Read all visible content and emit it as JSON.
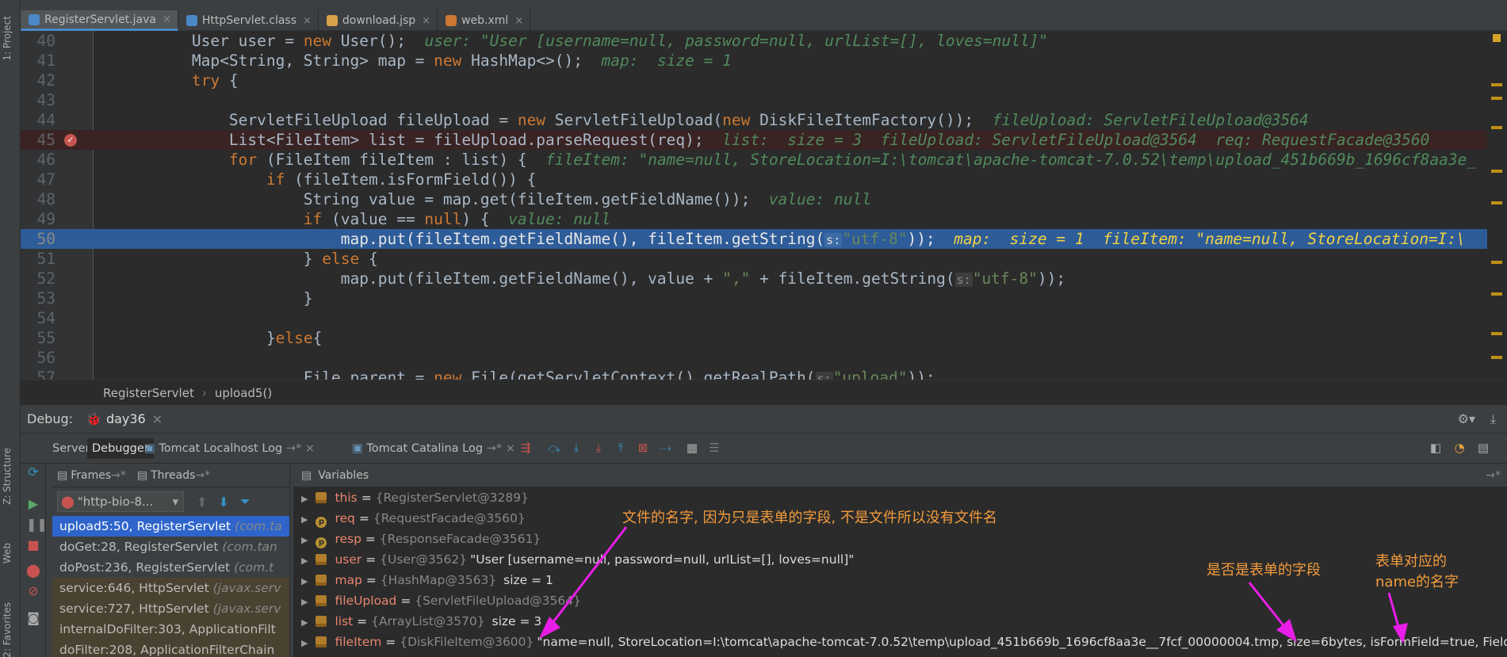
{
  "tabs": [
    {
      "label": "RegisterServlet.java",
      "color": "#4a88c7",
      "active": true
    },
    {
      "label": "HttpServlet.class",
      "color": "#4a88c7",
      "active": false
    },
    {
      "label": "download.jsp",
      "color": "#d6a14a",
      "active": false
    },
    {
      "label": "web.xml",
      "color": "#cc7832",
      "active": false
    }
  ],
  "left_toolwindows": {
    "project": "1: Project",
    "structure": "Z: Structure",
    "web": "Web",
    "favorites": "2: Favorites"
  },
  "code_lines": [
    {
      "num": "40",
      "parts": [
        [
          "",
          "        User user = "
        ],
        [
          "kw",
          "new"
        ],
        [
          "",
          " User();  "
        ],
        [
          "inl",
          "user: \"User [username=null, password=null, urlList=[], loves=null]\""
        ]
      ]
    },
    {
      "num": "41",
      "parts": [
        [
          "",
          "        Map<String, String> map = "
        ],
        [
          "kw",
          "new"
        ],
        [
          "",
          " HashMap<>();  "
        ],
        [
          "inl",
          "map:  size = 1"
        ]
      ]
    },
    {
      "num": "42",
      "parts": [
        [
          "kw",
          "        try"
        ],
        [
          "",
          " {"
        ]
      ]
    },
    {
      "num": "43",
      "parts": [
        [
          "",
          ""
        ]
      ]
    },
    {
      "num": "44",
      "parts": [
        [
          "",
          "            ServletFileUpload fileUpload = "
        ],
        [
          "kw",
          "new"
        ],
        [
          "",
          " ServletFileUpload("
        ],
        [
          "kw",
          "new"
        ],
        [
          "",
          " DiskFileItemFactory());  "
        ],
        [
          "inl",
          "fileUpload: ServletFileUpload@3564"
        ]
      ]
    },
    {
      "num": "45",
      "parts": [
        [
          "",
          "            List<FileItem> list = fileUpload.parseRequest(req);  "
        ],
        [
          "inl",
          "list:  size = 3  fileUpload: ServletFileUpload@3564  req: RequestFacade@3560"
        ]
      ]
    },
    {
      "num": "46",
      "parts": [
        [
          "kw",
          "            for"
        ],
        [
          "",
          " (FileItem fileItem : list) {  "
        ],
        [
          "inl",
          "fileItem: \"name=null, StoreLocation=I:\\tomcat\\apache-tomcat-7.0.52\\temp\\upload_451b669b_1696cf8aa3e_"
        ]
      ]
    },
    {
      "num": "47",
      "parts": [
        [
          "kw",
          "                if"
        ],
        [
          "",
          " (fileItem.isFormField()) {"
        ]
      ]
    },
    {
      "num": "48",
      "parts": [
        [
          "",
          "                    String value = map.get(fileItem.getFieldName());  "
        ],
        [
          "inl",
          "value: null"
        ]
      ]
    },
    {
      "num": "49",
      "parts": [
        [
          "kw",
          "                    if"
        ],
        [
          "",
          " (value == "
        ],
        [
          "kw",
          "null"
        ],
        [
          "",
          ") {  "
        ],
        [
          "inl",
          "value: null"
        ]
      ]
    },
    {
      "num": "50",
      "parts": [
        [
          "",
          "                        map.put(fileItem.getFieldName(), fileItem.getString("
        ],
        [
          "ph",
          "s:"
        ],
        [
          "str",
          "\"utf-8\""
        ],
        [
          "",
          "));  "
        ],
        [
          "inl",
          "map:  size = 1  fileItem: \"name=null, StoreLocation=I:\\"
        ]
      ]
    },
    {
      "num": "51",
      "parts": [
        [
          "",
          "                    } "
        ],
        [
          "kw",
          "else"
        ],
        [
          "",
          " {"
        ]
      ]
    },
    {
      "num": "52",
      "parts": [
        [
          "",
          "                        map.put(fileItem.getFieldName(), value + "
        ],
        [
          "str",
          "\",\""
        ],
        [
          "",
          " + fileItem.getString("
        ],
        [
          "ph",
          "s:"
        ],
        [
          "str",
          "\"utf-8\""
        ],
        [
          "",
          "));"
        ]
      ]
    },
    {
      "num": "53",
      "parts": [
        [
          "",
          "                    }"
        ]
      ]
    },
    {
      "num": "54",
      "parts": [
        [
          "",
          ""
        ]
      ]
    },
    {
      "num": "55",
      "parts": [
        [
          "",
          "                }"
        ],
        [
          "kw",
          "else"
        ],
        [
          "",
          "{"
        ]
      ]
    },
    {
      "num": "56",
      "parts": [
        [
          "",
          ""
        ]
      ]
    },
    {
      "num": "57",
      "parts": [
        [
          "",
          "                    File parent = "
        ],
        [
          "kw",
          "new"
        ],
        [
          "",
          " File(getServletContext().getRealPath("
        ],
        [
          "ph",
          "s:"
        ],
        [
          "str",
          "\"upload\""
        ],
        [
          "",
          "));"
        ]
      ]
    }
  ],
  "breakpoint_line": "45",
  "current_line": "50",
  "breadcrumb": {
    "class": "RegisterServlet",
    "method": "upload5()"
  },
  "debug": {
    "title": "Debug:",
    "session": "day36",
    "tabs": [
      "Server",
      "Debugger",
      "Tomcat Localhost Log",
      "Tomcat Catalina Log"
    ],
    "frames_label": "Frames",
    "threads_label": "Threads",
    "variables_label": "Variables",
    "thread": "\"http-bio-8...",
    "frames": [
      {
        "text": "upload5:50, RegisterServlet",
        "pkg": "(com.ta",
        "state": "sel"
      },
      {
        "text": "doGet:28, RegisterServlet",
        "pkg": "(com.tan",
        "state": ""
      },
      {
        "text": "doPost:236, RegisterServlet",
        "pkg": "(com.t",
        "state": ""
      },
      {
        "text": "service:646, HttpServlet",
        "pkg": "(javax.serv",
        "state": "lib"
      },
      {
        "text": "service:727, HttpServlet",
        "pkg": "(javax.serv",
        "state": "lib"
      },
      {
        "text": "internalDoFilter:303, ApplicationFilt",
        "pkg": "",
        "state": "lib"
      },
      {
        "text": "doFilter:208, ApplicationFilterChain",
        "pkg": "",
        "state": "lib"
      }
    ],
    "variables": [
      {
        "kind": "field",
        "name": "this",
        "ref": "{RegisterServlet@3289}",
        "value": ""
      },
      {
        "kind": "param",
        "name": "req",
        "ref": "{RequestFacade@3560}",
        "value": ""
      },
      {
        "kind": "param",
        "name": "resp",
        "ref": "{ResponseFacade@3561}",
        "value": ""
      },
      {
        "kind": "field",
        "name": "user",
        "ref": "{User@3562}",
        "value": "\"User [username=null, password=null, urlList=[], loves=null]\""
      },
      {
        "kind": "field",
        "name": "map",
        "ref": "{HashMap@3563}",
        "value": " size = 1"
      },
      {
        "kind": "field",
        "name": "fileUpload",
        "ref": "{ServletFileUpload@3564}",
        "value": ""
      },
      {
        "kind": "field",
        "name": "list",
        "ref": "{ArrayList@3570}",
        "value": " size = 3"
      },
      {
        "kind": "field",
        "name": "fileItem",
        "ref": "{DiskFileItem@3600}",
        "value": "\"name=null, StoreLocation=I:\\tomcat\\apache-tomcat-7.0.52\\temp\\upload_451b669b_1696cf8aa3e__7fcf_00000004.tmp, size=6bytes, isFormField=true, FieldName=password"
      }
    ]
  },
  "annotations": {
    "filename_note": "文件的名字, 因为只是表单的字段, 不是文件所以没有文件名",
    "formfield_note": "是否是表单的字段",
    "fieldname_note_1": "表单对应的",
    "fieldname_note_2": "name的名字"
  },
  "colors": {
    "annotation": "#f39c3c",
    "arrow": "#e81ee8",
    "selection": "#2d5c99",
    "breakpoint": "#c75450"
  }
}
